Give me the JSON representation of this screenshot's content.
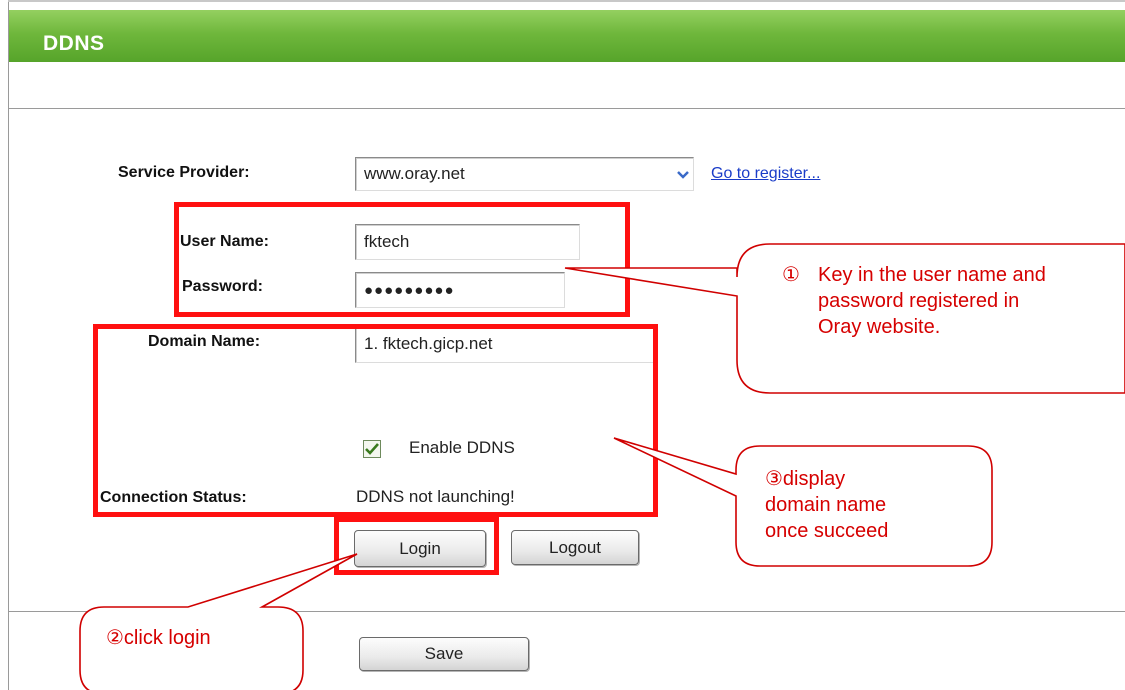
{
  "header": {
    "title": "DDNS"
  },
  "form": {
    "service_provider_label": "Service Provider:",
    "service_provider_value": "www.oray.net",
    "register_link": "Go to register...",
    "user_name_label": "User Name:",
    "user_name_value": "fktech",
    "password_label": "Password:",
    "password_value": "●●●●●●●●●",
    "domain_name_label": "Domain Name:",
    "domain_name_value": "1. fktech.gicp.net",
    "enable_ddns_label": "Enable DDNS",
    "enable_ddns_checked": true,
    "connection_status_label": "Connection Status:",
    "connection_status_value": "DDNS not launching!"
  },
  "buttons": {
    "login": "Login",
    "logout": "Logout",
    "save": "Save"
  },
  "annotations": {
    "callout1_marker": "①",
    "callout1_lines": [
      "Key in the user name and",
      "password registered in",
      "Oray website."
    ],
    "callout2": "②click login",
    "callout3_lines": [
      "③display",
      "domain name",
      "once succeed"
    ],
    "color": "#ff0000"
  },
  "icons": {
    "dropdown": "chevron-down-icon",
    "checkbox": "checkmark-icon"
  },
  "colors": {
    "header_green": "#6fb73c",
    "link_blue": "#1a3cc8",
    "annotation_red": "#ff0000"
  }
}
